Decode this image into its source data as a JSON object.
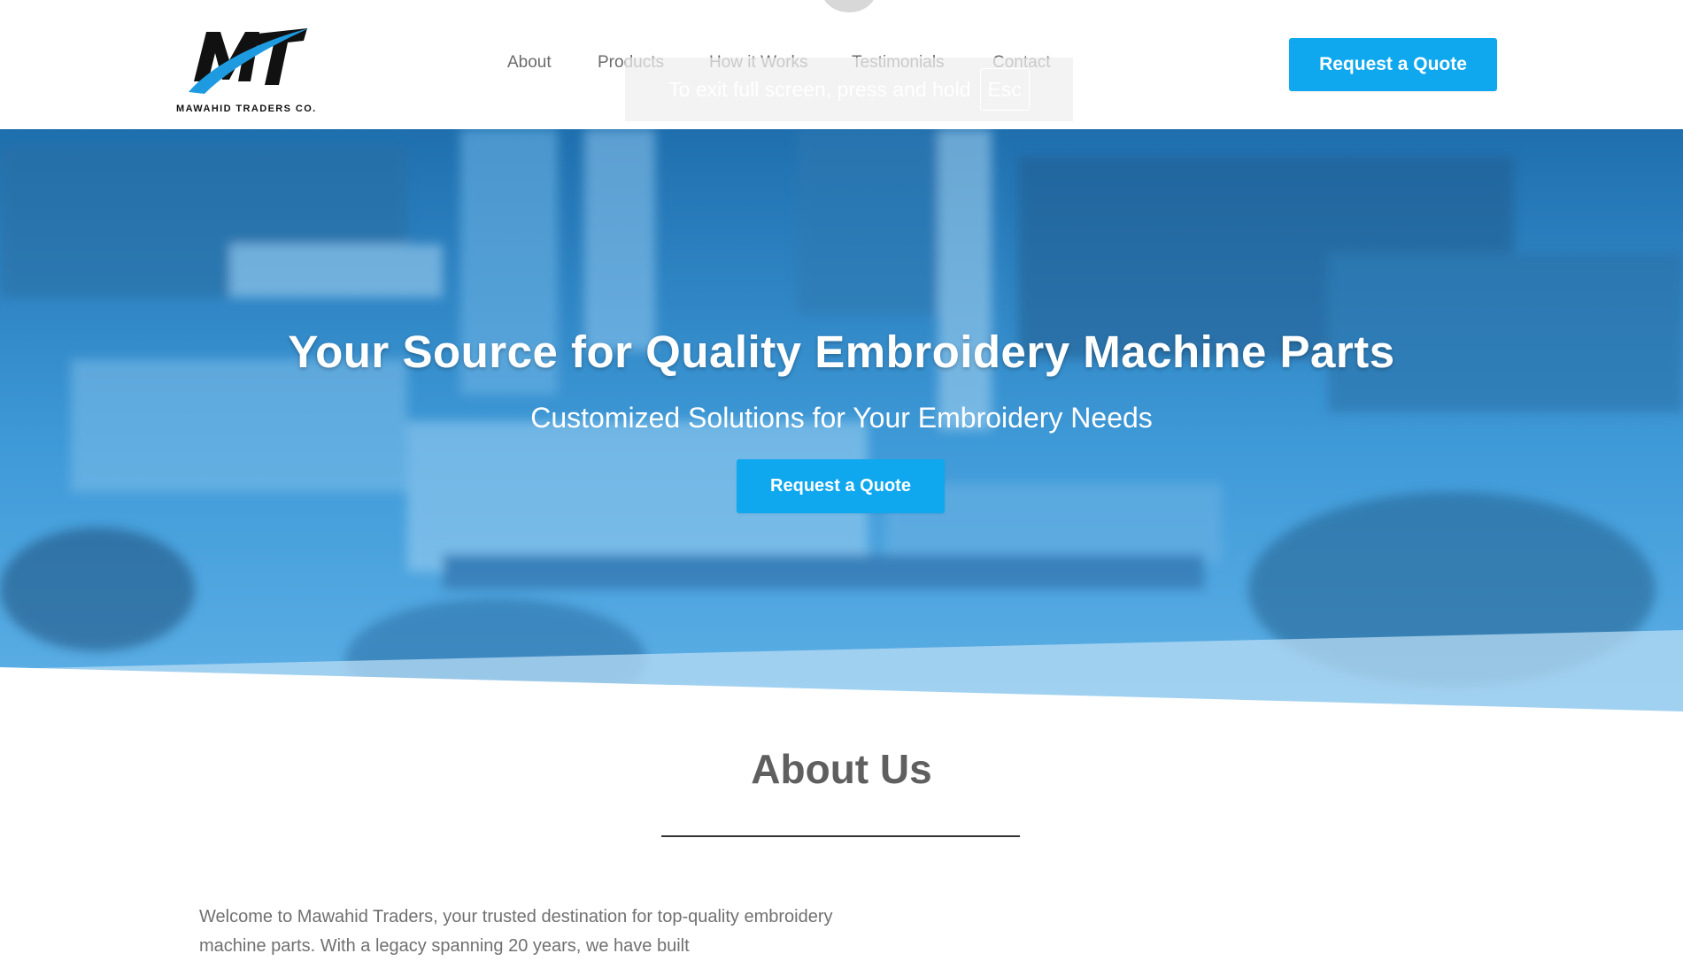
{
  "brand": {
    "name": "MAWAHID TRADERS CO.",
    "logo_letters": "MT",
    "accent": "#0fa8ef"
  },
  "nav": {
    "items": [
      {
        "label": "About"
      },
      {
        "label": "Products"
      },
      {
        "label": "How it Works"
      },
      {
        "label": "Testimonials"
      },
      {
        "label": "Contact"
      }
    ],
    "cta_label": "Request a Quote"
  },
  "fullscreen_notice": {
    "text": "To exit full screen, press and hold",
    "key": "Esc"
  },
  "hero": {
    "title": "Your Source for Quality Embroidery Machine Parts",
    "subtitle": "Customized Solutions for Your Embroidery Needs",
    "cta_label": "Request a Quote"
  },
  "about": {
    "title": "About Us",
    "intro": "Welcome to Mawahid Traders, your trusted destination for top-quality embroidery machine parts. With a legacy spanning 20 years, we have built"
  },
  "colors": {
    "button": "#0fa8ef",
    "hero_overlay": "#2f8fd0",
    "heading": "#5f5f5f"
  }
}
